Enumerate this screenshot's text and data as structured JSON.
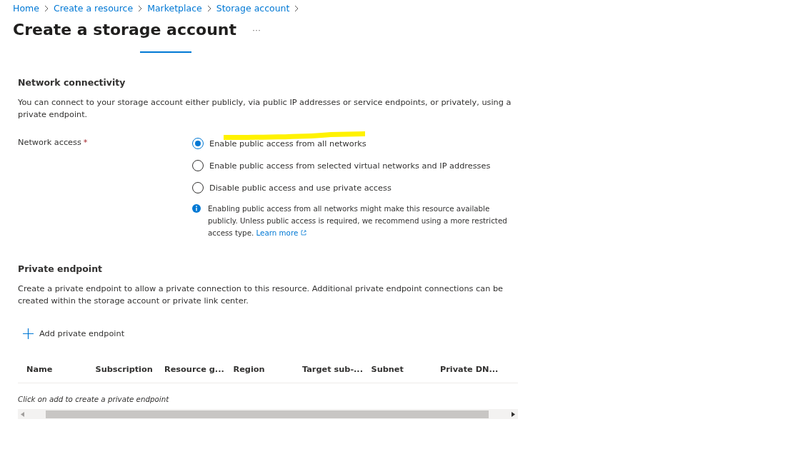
{
  "breadcrumb": [
    "Home",
    "Create a resource",
    "Marketplace",
    "Storage account"
  ],
  "title": "Create a storage account",
  "more_label": "···",
  "network": {
    "heading": "Network connectivity",
    "description": "You can connect to your storage account either publicly, via public IP addresses or service endpoints, or privately, using a private endpoint.",
    "field_label": "Network access",
    "required_mark": "*",
    "options": [
      {
        "label": "Enable public access from all networks",
        "selected": true
      },
      {
        "label": "Enable public access from selected virtual networks and IP addresses",
        "selected": false
      },
      {
        "label": "Disable public access and use private access",
        "selected": false
      }
    ],
    "info": "Enabling public access from all networks might make this resource available publicly. Unless public access is required, we recommend using a more restricted access type.",
    "info_link": "Learn more"
  },
  "private_endpoint": {
    "heading": "Private endpoint",
    "description": "Create a private endpoint to allow a private connection to this resource. Additional private endpoint connections can be created within the storage account or private link center.",
    "add_label": "Add private endpoint",
    "columns": [
      "Name",
      "Subscription",
      "Resource g...",
      "Region",
      "Target sub-...",
      "Subnet",
      "Private DN..."
    ],
    "empty_text": "Click on add to create a private endpoint"
  }
}
